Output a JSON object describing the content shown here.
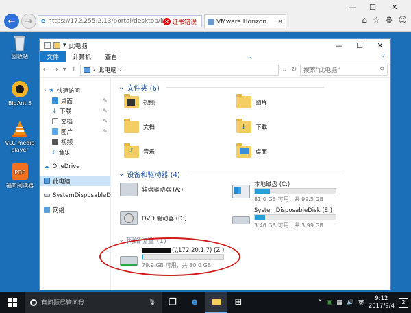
{
  "browser": {
    "url": "https://172.255.2.13/portal/desktop/in",
    "cert_error": "证书错误",
    "tab_title": "VMware Horizon",
    "window_controls": {
      "minimize": "—",
      "maximize": "☐",
      "close": "✕"
    }
  },
  "desktop_icons": [
    {
      "label": "回收站",
      "icon": "recycle-bin-icon"
    },
    {
      "label": "BigAnt 5",
      "icon": "bigant-icon"
    },
    {
      "label": "VLC media player",
      "icon": "vlc-icon"
    },
    {
      "label": "福昕阅读器",
      "icon": "foxit-pdf-icon"
    }
  ],
  "explorer": {
    "title": "此电脑",
    "ribbon_tabs": [
      "文件",
      "计算机",
      "查看"
    ],
    "address": {
      "path": "此电脑",
      "search_placeholder": "搜索\"此电脑\""
    },
    "nav_pane": [
      {
        "label": "快速访问",
        "icon": "star-icon",
        "level": 0
      },
      {
        "label": "桌面",
        "icon": "desktop-icon",
        "level": 1,
        "pinned": true
      },
      {
        "label": "下载",
        "icon": "download-icon",
        "level": 1,
        "pinned": true
      },
      {
        "label": "文档",
        "icon": "document-icon",
        "level": 1,
        "pinned": true
      },
      {
        "label": "图片",
        "icon": "picture-icon",
        "level": 1,
        "pinned": true
      },
      {
        "label": "视频",
        "icon": "video-icon",
        "level": 1
      },
      {
        "label": "音乐",
        "icon": "music-icon",
        "level": 1
      },
      {
        "label": "OneDrive",
        "icon": "onedrive-icon",
        "level": 0
      },
      {
        "label": "此电脑",
        "icon": "computer-icon",
        "level": 0,
        "selected": true
      },
      {
        "label": "SystemDisposableD",
        "icon": "drive-icon",
        "level": 0
      },
      {
        "label": "网络",
        "icon": "network-icon",
        "level": 0
      }
    ],
    "folders_header": "文件夹 (6)",
    "folders": [
      {
        "label": "视频",
        "icon": "video-folder-icon"
      },
      {
        "label": "图片",
        "icon": "picture-folder-icon"
      },
      {
        "label": "文档",
        "icon": "document-folder-icon"
      },
      {
        "label": "下载",
        "icon": "download-folder-icon"
      },
      {
        "label": "音乐",
        "icon": "music-folder-icon"
      },
      {
        "label": "桌面",
        "icon": "desktop-folder-icon"
      }
    ],
    "devices_header": "设备和驱动器 (4)",
    "devices": [
      {
        "label": "软盘驱动器 (A:)",
        "icon": "floppy-drive-icon"
      },
      {
        "label": "本地磁盘 (C:)",
        "icon": "local-disk-icon",
        "info": "81.0 GB 可用，共 99.5 GB",
        "used_fraction": 0.19
      },
      {
        "label": "DVD 驱动器 (D:)",
        "icon": "dvd-drive-icon"
      },
      {
        "label": "SystemDisposableDisk (E:)",
        "icon": "disposable-disk-icon",
        "info": "3.46 GB 可用，共 3.99 GB",
        "used_fraction": 0.13
      }
    ],
    "network_header": "网络位置 (1)",
    "network": [
      {
        "label": "(\\\\172.20.1.7) (Z:)",
        "icon": "network-drive-icon",
        "info": "79.9 GB 可用，共 80.0 GB",
        "used_fraction": 0.01
      }
    ],
    "colors": {
      "accent": "#1979ca",
      "selection": "#cce4f7",
      "bar_fill": "#26a0da",
      "annotation": "#d21a1a"
    }
  },
  "taskbar": {
    "search_placeholder": "有问题尽管问我",
    "ime": "英",
    "time": "9:12",
    "date": "2017/9/4",
    "notification_count": "2"
  }
}
